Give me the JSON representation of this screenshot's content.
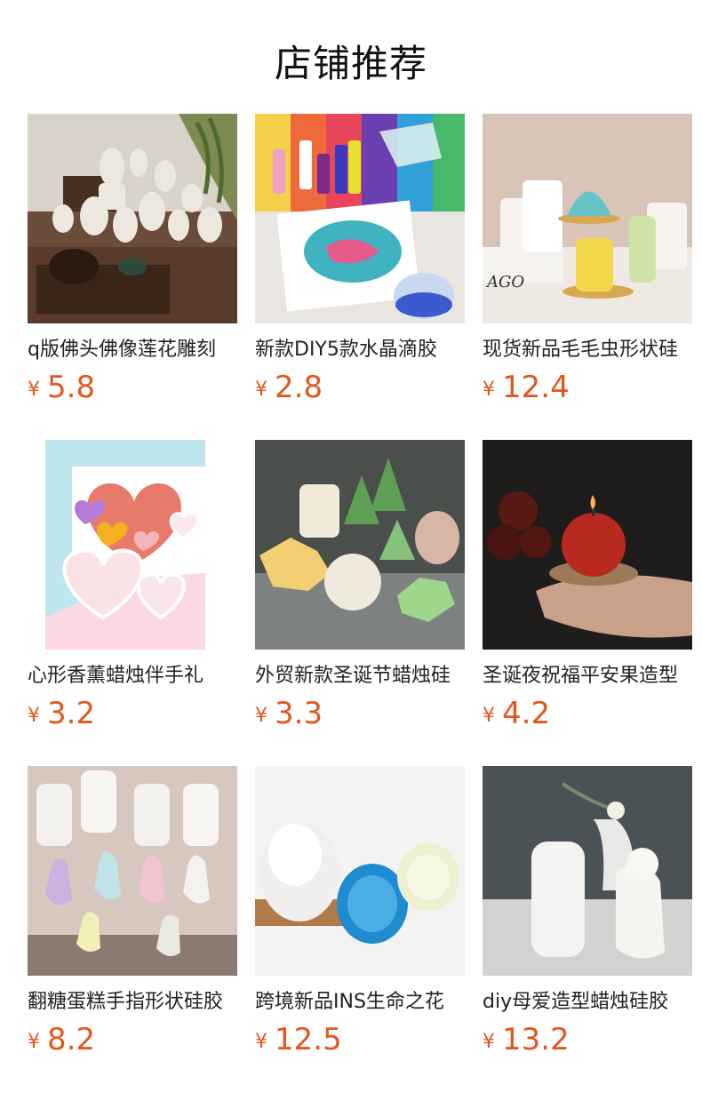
{
  "page_title": "店铺推荐",
  "currency_symbol": "¥",
  "price_color": "#e4571c",
  "products": [
    {
      "name": "q版佛头佛像莲花雕刻",
      "price": "5.8",
      "image": "buddha-statues-image"
    },
    {
      "name": "新款DIY5款水晶滴胶",
      "price": "2.8",
      "image": "resin-pour-art-image"
    },
    {
      "name": "现货新品毛毛虫形状硅",
      "price": "12.4",
      "image": "caterpillar-candles-image"
    },
    {
      "name": "心形香薰蜡烛伴手礼",
      "price": "3.2",
      "image": "heart-molds-image"
    },
    {
      "name": "外贸新款圣诞节蜡烛硅",
      "price": "3.3",
      "image": "christmas-candles-image"
    },
    {
      "name": "圣诞夜祝福平安果造型",
      "price": "4.2",
      "image": "apple-candle-image"
    },
    {
      "name": "翻糖蛋糕手指形状硅胶",
      "price": "8.2",
      "image": "finger-candles-image"
    },
    {
      "name": "跨境新品INS生命之花",
      "price": "12.5",
      "image": "pinecone-candles-image"
    },
    {
      "name": "diy母爱造型蜡烛硅胶",
      "price": "13.2",
      "image": "mother-love-candle-image"
    }
  ]
}
